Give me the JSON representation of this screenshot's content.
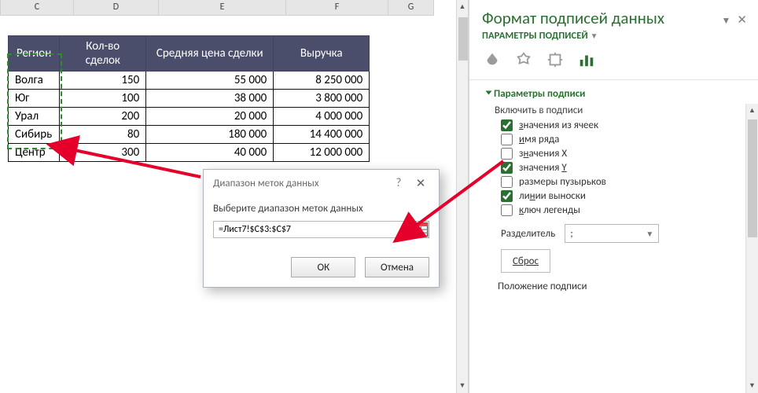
{
  "columns": [
    "C",
    "D",
    "E",
    "F",
    "G"
  ],
  "table": {
    "headers": [
      "Регион",
      "Кол-во сделок",
      "Средняя цена сделки",
      "Выручка"
    ],
    "rows": [
      {
        "region": "Волга",
        "deals": "150",
        "avg": "55 000",
        "rev": "8 250 000"
      },
      {
        "region": "Юг",
        "deals": "100",
        "avg": "38 000",
        "rev": "3 800 000"
      },
      {
        "region": "Урал",
        "deals": "200",
        "avg": "20 000",
        "rev": "4 000 000"
      },
      {
        "region": "Сибирь",
        "deals": "80",
        "avg": "180 000",
        "rev": "14 400 000"
      },
      {
        "region": "Центр",
        "deals": "300",
        "avg": "40 000",
        "rev": "12 000 000"
      }
    ]
  },
  "dialog": {
    "title": "Диапазон меток данных",
    "prompt": "Выберите диапазон меток данных",
    "value": "=Лист7!$C$3:$C$7",
    "ok": "ОК",
    "cancel": "Отмена"
  },
  "pane": {
    "title": "Формат подписей данных",
    "subtitle": "Параметры подписей",
    "section": "Параметры подписи",
    "include": "Включить в подписи",
    "checks": [
      {
        "label": "значения из ячеек",
        "checked": true,
        "u": 0
      },
      {
        "label": "имя ряда",
        "checked": false,
        "u": 0
      },
      {
        "label": "значения X",
        "checked": false,
        "u": 1
      },
      {
        "label": "значения Y",
        "checked": true,
        "u": 9
      },
      {
        "label": "размеры пузырьков",
        "checked": false,
        "u": -1
      },
      {
        "label": "линии выноски",
        "checked": true,
        "u": 2
      },
      {
        "label": "ключ легенды",
        "checked": false,
        "u": 0
      }
    ],
    "sep_label": "Разделитель",
    "sep_value": ";",
    "reset": "Сброс",
    "position": "Положение подписи"
  }
}
